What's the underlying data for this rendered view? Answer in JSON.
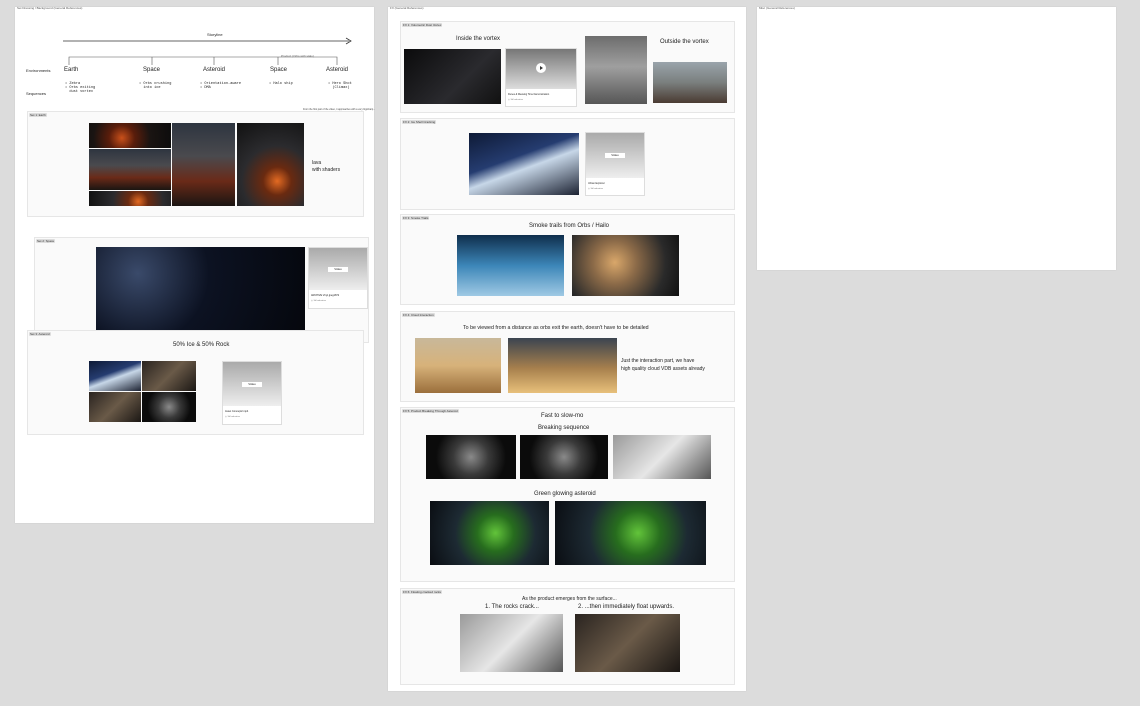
{
  "boards": {
    "left": {
      "tag": "Set Dressing / Background (General References)"
    },
    "middle": {
      "tag": "FX (General References)"
    },
    "right": {
      "tag": "Misc (General References)"
    }
  },
  "storyline": {
    "label": "Storyline",
    "side_note": "Product (Orbs with Halo)",
    "row_env": "Environments",
    "row_seq": "Sequences",
    "stages": [
      {
        "name": "Earth",
        "seq": "• Zebra\n• Orbs exiting\n  dust vortex"
      },
      {
        "name": "Space",
        "seq": "• Orbs crushing\n  into ice"
      },
      {
        "name": "Asteroid",
        "seq": "• Orientation-aware\n• DMA"
      },
      {
        "name": "Space",
        "seq": "• Halo ship"
      },
      {
        "name": "Asteroid",
        "seq": "• Hero Shot\n  (Climax)"
      }
    ],
    "note_right": "From the first part of the video, it approaches with a very big/sharp..."
  },
  "left_sections": {
    "earth": {
      "tag": "Set 1: Earth",
      "caption": "lava\nwith shaders"
    },
    "space": {
      "tag": "Set 2: Space",
      "card_title": "ARCHIVE Vinyl.jpeg1872",
      "card_sub": "◎ 3d Industries",
      "card_btn": "Video"
    },
    "asteroid": {
      "tag": "Set 3: Asteroid",
      "title": "50% Ice & 50% Rock",
      "card_title": "Asset Concept2.mp4",
      "card_sub": "◎ 3d Industries",
      "card_btn": "Video"
    }
  },
  "fx_sections": {
    "vortex": {
      "tag": "FX 1: Volumetric Dust Vortex",
      "inside": "Inside the vortex",
      "outside": "Outside the vortex",
      "card_title": "Dunes & Weaving Time Demonstration",
      "card_sub": "◎ 3d Industries"
    },
    "ice": {
      "tag": "FX 2: Ice Shell Cracking",
      "card_title": "Urban Explorer",
      "card_sub": "◎ 3d Industries",
      "card_btn": "Video"
    },
    "smoke": {
      "tag": "FX 3: Smoke Trails",
      "title": "Smoke trails from Orbs / Hailo"
    },
    "cloud": {
      "tag": "FX 4: Cloud Interaction",
      "title": "To be viewed from a distance as orbs exit the earth, doesn't have to be detailed",
      "note": "Just the interaction part, we have\nhigh quality cloud VDB assets already"
    },
    "breaking": {
      "tag": "FX 5: Product Breaking Through Asteroid",
      "title": "Fast to slow-mo",
      "sub1": "Breaking sequence",
      "sub2": "Green glowing asteroid"
    },
    "rocks": {
      "tag": "FX 6: Floating cracked rocks",
      "title": "As the product emerges from the surface...",
      "step1": "1. The rocks crack...",
      "step2": "2. ...then immediately float upwards."
    }
  },
  "play_icon": "play-icon"
}
